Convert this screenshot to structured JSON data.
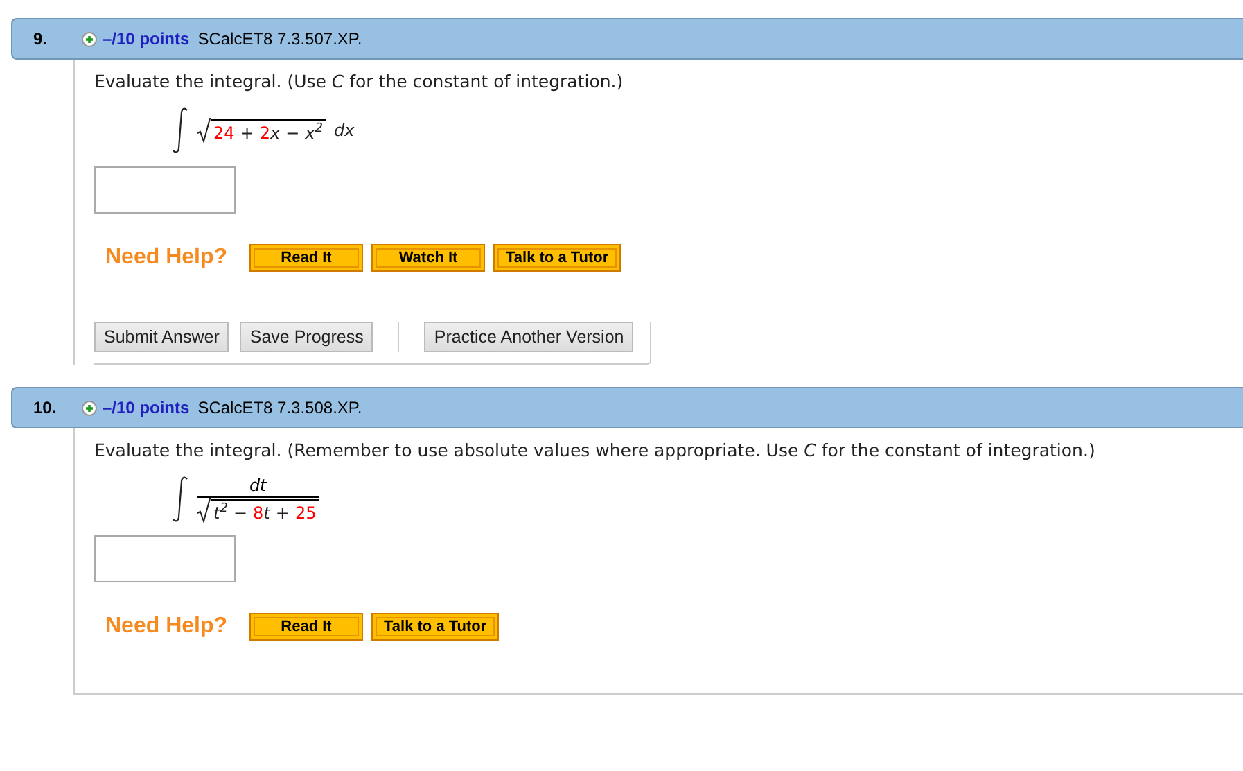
{
  "problems": [
    {
      "number": "9.",
      "points": "–/10 points",
      "source": "SCalcET8 7.3.507.XP.",
      "prompt": "Evaluate the integral. (Use *C* for the constant of integration.)",
      "integral": {
        "kind": "root",
        "radicand": [
          {
            "kind": "num",
            "text": "24"
          },
          {
            "kind": "op",
            "text": "+"
          },
          {
            "kind": "num",
            "text": "2"
          },
          {
            "kind": "var",
            "text": "x"
          },
          {
            "kind": "op",
            "text": "−"
          },
          {
            "kind": "var",
            "text": "x$^{2}$"
          }
        ],
        "differential": "dx"
      },
      "need_help": "Need Help?",
      "help_buttons": [
        "Read It",
        "Watch It",
        "Talk to a Tutor"
      ],
      "actions": [
        "Submit Answer",
        "Save Progress"
      ],
      "practice": "Practice Another Version"
    },
    {
      "number": "10.",
      "points": "–/10 points",
      "source": "SCalcET8 7.3.508.XP.",
      "prompt": "Evaluate the integral. (Remember to use absolute values where appropriate. Use *C* for the constant of integration.)",
      "integral": {
        "kind": "fraction",
        "numerator": "dt",
        "radicand": [
          {
            "kind": "var",
            "text": "t$^{2}$"
          },
          {
            "kind": "op",
            "text": "−"
          },
          {
            "kind": "num",
            "text": "8"
          },
          {
            "kind": "var",
            "text": "t"
          },
          {
            "kind": "op",
            "text": "+"
          },
          {
            "kind": "num",
            "text": "25"
          }
        ]
      },
      "need_help": "Need Help?",
      "help_buttons": [
        "Read It",
        "Talk to a Tutor"
      ]
    }
  ]
}
